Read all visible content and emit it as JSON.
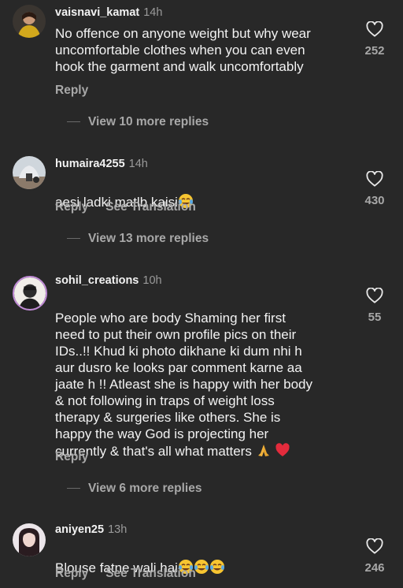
{
  "comments": [
    {
      "username": "vaisnavi_kamat",
      "time": "14h",
      "text": "No offence on anyone weight but why wear\nuncomfortable clothes when you can even\nhook the garment and walk uncomfortably",
      "reply_label": "Reply",
      "likes": "252",
      "replies_label": "View 10 more replies"
    },
    {
      "username": "humaira4255",
      "time": "14h",
      "text": "aesi ladki matlb kaisi",
      "reply_label": "Reply",
      "translate_label": "See Translation",
      "likes": "430",
      "replies_label": "View 13 more replies"
    },
    {
      "username": "sohil_creations",
      "time": "10h",
      "text": "People who are body Shaming her first\nneed to put their own profile pics on their\nIDs..!! Khud ki photo dikhane ki dum nhi h\naur dusro ke looks par comment karne aa\njaate h !! Atleast she is happy with her body\n& not following in traps of weight loss\ntherapy & surgeries like others. She is\nhappy the way God is projecting her\ncurrently & that's all what matters",
      "reply_label": "Reply",
      "likes": "55",
      "replies_label": "View 6 more replies"
    },
    {
      "username": "aniyen25",
      "time": "13h",
      "text": "Blouse fatne wali hai",
      "reply_label": "Reply",
      "translate_label": "See Translation",
      "likes": "246"
    }
  ],
  "icons": {
    "like": "heart-outline-icon",
    "laugh": "face-with-tears-of-joy-emoji",
    "pray": "folded-hands-emoji",
    "heart": "red-heart-emoji"
  },
  "colors": {
    "background": "#282828",
    "text": "#f2f2f2",
    "muted": "#a8a8a8"
  }
}
